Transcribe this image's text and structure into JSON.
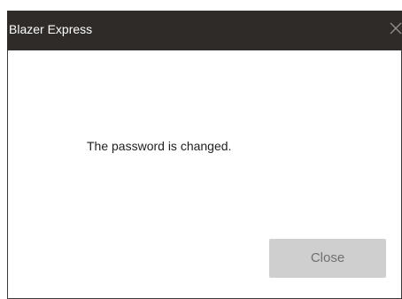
{
  "window": {
    "title": "Blazer Express",
    "close_icon": "close-icon"
  },
  "dialog": {
    "message": "The password is changed.",
    "close_button_label": "Close"
  },
  "colors": {
    "titlebar_bg": "#2e2b29",
    "title_text": "#ffffff",
    "button_bg": "#cfcfcf",
    "button_text": "#6f6f6f"
  }
}
